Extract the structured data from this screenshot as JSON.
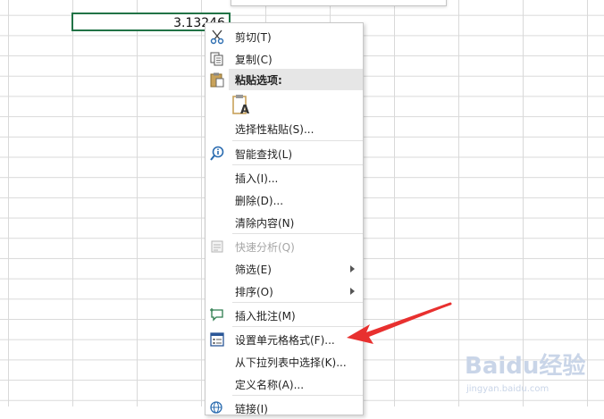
{
  "cell": {
    "value": "3.13246"
  },
  "menu": {
    "items": {
      "cut": {
        "label": "剪切(T)",
        "icon": "scissors-icon"
      },
      "copy": {
        "label": "复制(C)",
        "icon": "copy-icon"
      },
      "paste_options": {
        "label": "粘贴选项:",
        "icon": "clipboard-icon"
      },
      "paste_special": {
        "label": "选择性粘贴(S)..."
      },
      "smart_lookup": {
        "label": "智能查找(L)",
        "icon": "info-search-icon"
      },
      "insert": {
        "label": "插入(I)..."
      },
      "delete": {
        "label": "删除(D)..."
      },
      "clear_contents": {
        "label": "清除内容(N)"
      },
      "quick_analysis": {
        "label": "快速分析(Q)",
        "icon": "quick-analysis-icon",
        "disabled": true
      },
      "filter": {
        "label": "筛选(E)",
        "has_submenu": true
      },
      "sort": {
        "label": "排序(O)",
        "has_submenu": true
      },
      "insert_comment": {
        "label": "插入批注(M)",
        "icon": "comment-icon"
      },
      "format_cells": {
        "label": "设置单元格格式(F)...",
        "icon": "format-cells-icon"
      },
      "pick_from_list": {
        "label": "从下拉列表中选择(K)..."
      },
      "define_name": {
        "label": "定义名称(A)..."
      },
      "link": {
        "label": "链接(I)",
        "icon": "link-icon"
      }
    }
  },
  "colors": {
    "cell_border": "#217346",
    "arrow": "#e8302f",
    "gridline": "#d9d9d9",
    "paste_header_bg": "#e6e6e6"
  },
  "watermark": {
    "text": "Baidu经验",
    "sub": "jingyan.baidu.com"
  }
}
